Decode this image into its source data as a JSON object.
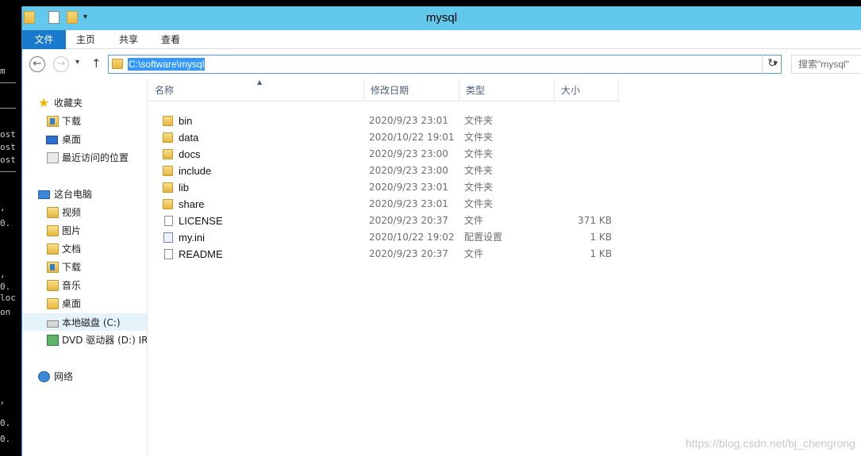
{
  "window": {
    "title": "mysql"
  },
  "ribbon": {
    "tabs": [
      "文件",
      "主页",
      "共享",
      "查看"
    ]
  },
  "nav": {
    "address": "C:\\software\\mysql",
    "search_placeholder": "搜索\"mysql\""
  },
  "sidebar": {
    "items": [
      {
        "label": "收藏夹",
        "icon": "star-icon"
      },
      {
        "label": "下载",
        "icon": "downloads-folder-icon"
      },
      {
        "label": "桌面",
        "icon": "desktop-icon"
      },
      {
        "label": "最近访问的位置",
        "icon": "recent-places-icon"
      },
      {
        "label": "这台电脑",
        "icon": "computer-icon"
      },
      {
        "label": "视频",
        "icon": "videos-folder-icon"
      },
      {
        "label": "图片",
        "icon": "pictures-folder-icon"
      },
      {
        "label": "文档",
        "icon": "documents-folder-icon"
      },
      {
        "label": "下载",
        "icon": "downloads-folder-icon"
      },
      {
        "label": "音乐",
        "icon": "music-folder-icon"
      },
      {
        "label": "桌面",
        "icon": "desktop-folder-icon"
      },
      {
        "label": "本地磁盘 (C:)",
        "icon": "local-disk-icon"
      },
      {
        "label": "DVD 驱动器 (D:) IR",
        "icon": "dvd-drive-icon"
      },
      {
        "label": "网络",
        "icon": "network-icon"
      }
    ]
  },
  "columns": {
    "name": "名称",
    "date": "修改日期",
    "type": "类型",
    "size": "大小"
  },
  "files": [
    {
      "name": "bin",
      "date": "2020/9/23 23:01",
      "type": "文件夹",
      "size": "",
      "icon": "folder-icon"
    },
    {
      "name": "data",
      "date": "2020/10/22 19:01",
      "type": "文件夹",
      "size": "",
      "icon": "folder-icon"
    },
    {
      "name": "docs",
      "date": "2020/9/23 23:00",
      "type": "文件夹",
      "size": "",
      "icon": "folder-icon"
    },
    {
      "name": "include",
      "date": "2020/9/23 23:00",
      "type": "文件夹",
      "size": "",
      "icon": "folder-icon"
    },
    {
      "name": "lib",
      "date": "2020/9/23 23:01",
      "type": "文件夹",
      "size": "",
      "icon": "folder-icon"
    },
    {
      "name": "share",
      "date": "2020/9/23 23:01",
      "type": "文件夹",
      "size": "",
      "icon": "folder-icon"
    },
    {
      "name": "LICENSE",
      "date": "2020/9/23 20:37",
      "type": "文件",
      "size": "371 KB",
      "icon": "file-icon"
    },
    {
      "name": "my.ini",
      "date": "2020/10/22 19:02",
      "type": "配置设置",
      "size": "1 KB",
      "icon": "config-file-icon"
    },
    {
      "name": "README",
      "date": "2020/9/23 20:37",
      "type": "文件",
      "size": "1 KB",
      "icon": "file-icon"
    }
  ],
  "watermark": "https://blog.csdn.net/bj_chengrong",
  "console_fragments": [
    "m",
    "———",
    "———",
    "ost",
    "ost",
    "ost",
    "———",
    ",",
    "0.",
    ",",
    "0.",
    "loc",
    "on",
    "，",
    "0.",
    "0.",
    ",",
    "0."
  ],
  "colors": {
    "titlebar": "#62c8ec",
    "file_tab": "#1979ca",
    "address_selection": "#3399ff",
    "selected_item": "#e5f3fb"
  }
}
